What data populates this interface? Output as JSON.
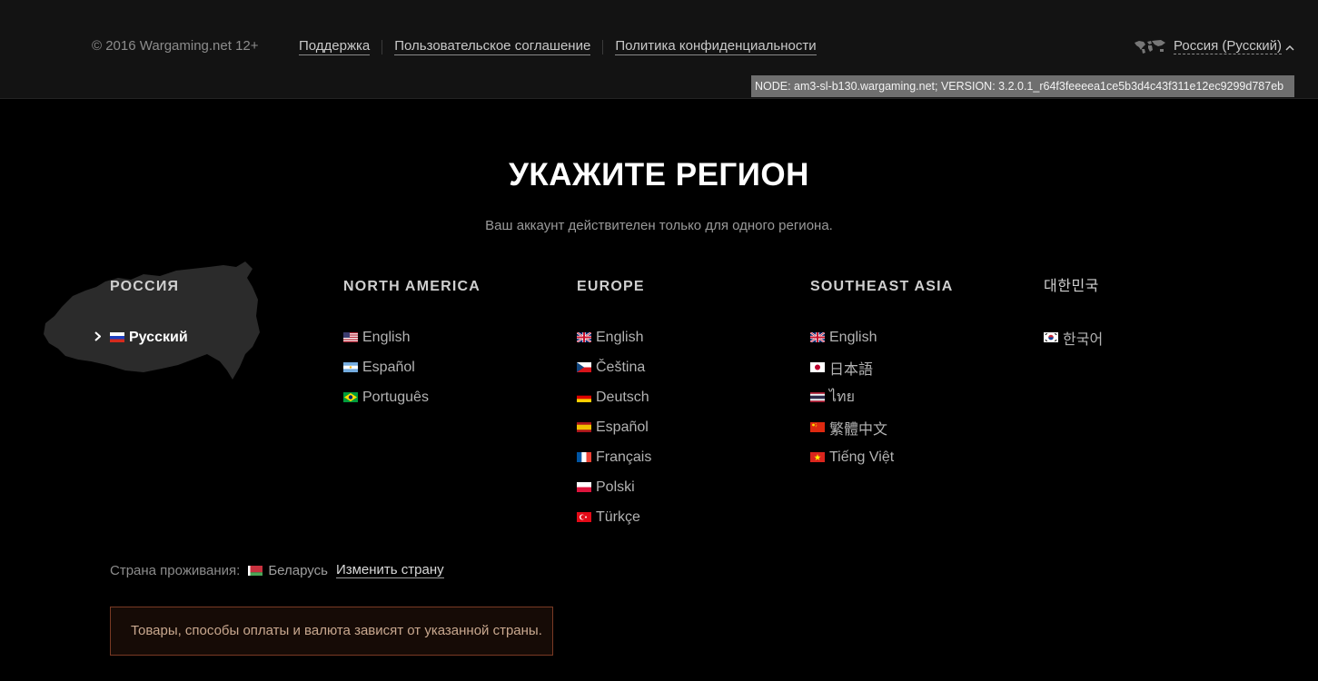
{
  "footer": {
    "copyright": "© 2016 Wargaming.net 12+",
    "links": [
      "Поддержка",
      "Пользовательское соглашение",
      "Политика конфиденциальности"
    ],
    "region_selector": {
      "label": "Россия (Русский)",
      "icon": "world-map-icon",
      "chevron": "chevron-up-icon"
    },
    "node_info": "NODE: am3-sl-b130.wargaming.net; VERSION: 3.2.0.1_r64f3feeeea1ce5b3d4c43f311e12ec9299d787eb"
  },
  "heading": {
    "title": "УКАЖИТЕ РЕГИОН",
    "subtitle": "Ваш аккаунт действителен только для одного региона."
  },
  "regions": [
    {
      "name": "РОССИЯ",
      "languages": [
        {
          "label": "Русский",
          "flag": "ru",
          "active": true
        }
      ]
    },
    {
      "name": "NORTH AMERICA",
      "languages": [
        {
          "label": "English",
          "flag": "us"
        },
        {
          "label": "Español",
          "flag": "ar"
        },
        {
          "label": "Português",
          "flag": "br"
        }
      ]
    },
    {
      "name": "EUROPE",
      "languages": [
        {
          "label": "English",
          "flag": "gb"
        },
        {
          "label": "Čeština",
          "flag": "cz"
        },
        {
          "label": "Deutsch",
          "flag": "de"
        },
        {
          "label": "Español",
          "flag": "es"
        },
        {
          "label": "Français",
          "flag": "fr"
        },
        {
          "label": "Polski",
          "flag": "pl"
        },
        {
          "label": "Türkçe",
          "flag": "tr"
        }
      ]
    },
    {
      "name": "SOUTHEAST ASIA",
      "languages": [
        {
          "label": "English",
          "flag": "gb"
        },
        {
          "label": "日本語",
          "flag": "jp"
        },
        {
          "label": "ไทย",
          "flag": "th"
        },
        {
          "label": "繁體中文",
          "flag": "cn"
        },
        {
          "label": "Tiếng Việt",
          "flag": "vn"
        }
      ]
    },
    {
      "name": "대한민국",
      "languages": [
        {
          "label": "한국어",
          "flag": "kr"
        }
      ]
    }
  ],
  "country": {
    "label": "Страна проживания:",
    "value": "Беларусь",
    "flag": "by",
    "change_link": "Изменить страну"
  },
  "notice": "Товары, способы оплаты и валюта зависят от указанной страны.",
  "colors": {
    "background": "#000000",
    "footer_bg": "#131313",
    "notice_border": "#7a3a24",
    "node_bg": "#6f6f6f"
  }
}
